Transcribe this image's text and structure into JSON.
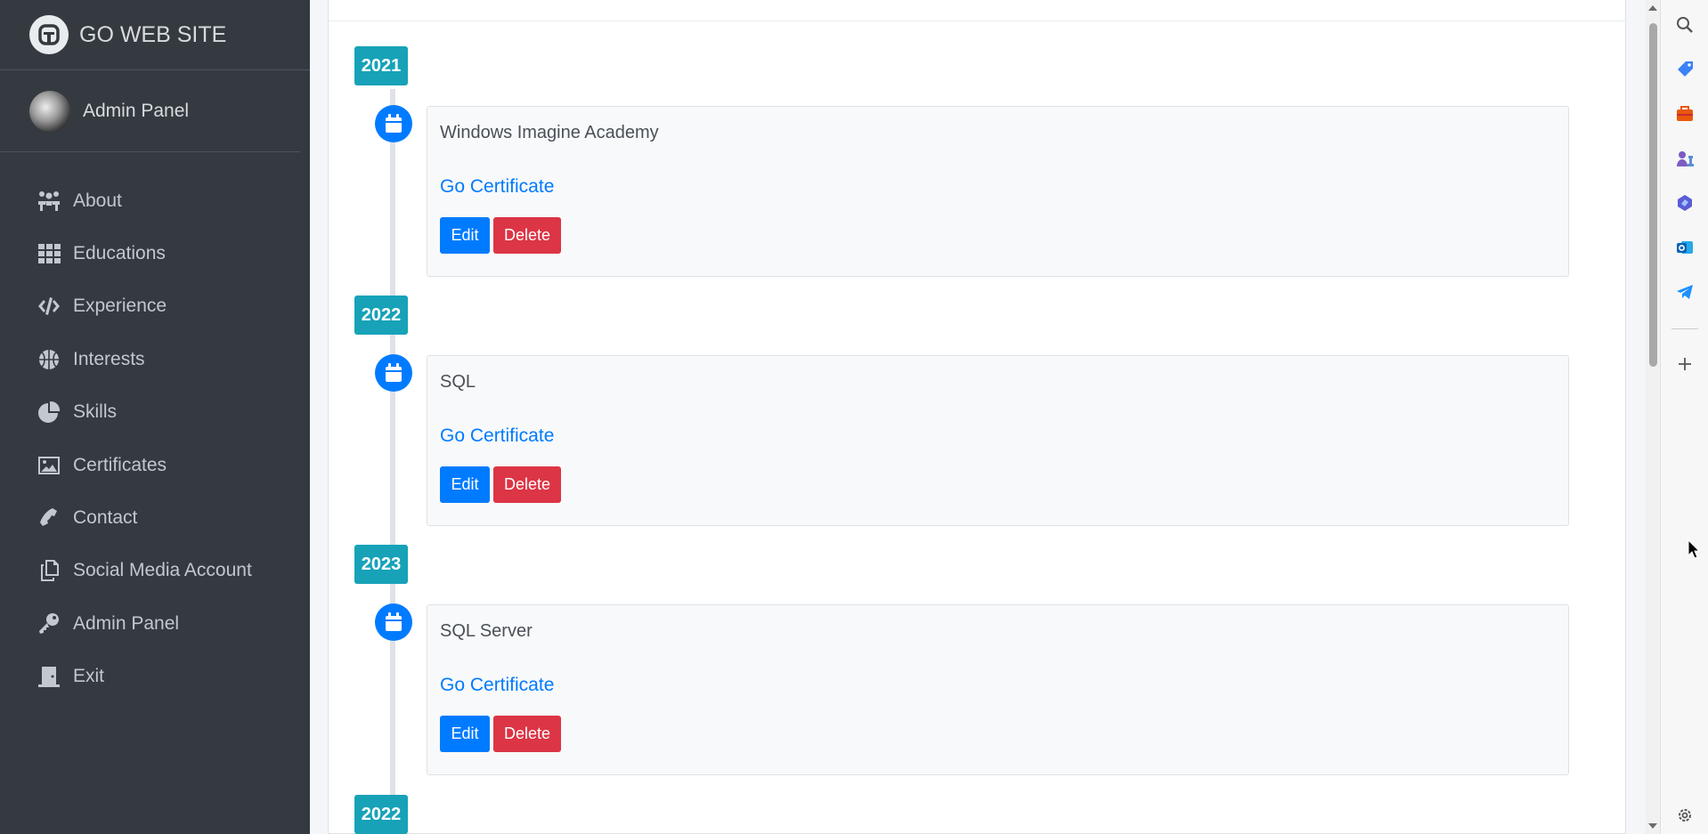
{
  "brand": {
    "name": "GO WEB SITE"
  },
  "user": {
    "name": "Admin Panel"
  },
  "sidebar": {
    "items": [
      {
        "label": "About",
        "icon": "users-icon"
      },
      {
        "label": "Educations",
        "icon": "grid-icon"
      },
      {
        "label": "Experience",
        "icon": "code-icon"
      },
      {
        "label": "Interests",
        "icon": "basketball-icon"
      },
      {
        "label": "Skills",
        "icon": "pie-chart-icon"
      },
      {
        "label": "Certificates",
        "icon": "image-icon"
      },
      {
        "label": "Contact",
        "icon": "phone-icon"
      },
      {
        "label": "Social Media Account",
        "icon": "copy-icon"
      },
      {
        "label": "Admin Panel",
        "icon": "key-icon"
      },
      {
        "label": "Exit",
        "icon": "door-exit-icon"
      }
    ]
  },
  "timeline": {
    "entries": [
      {
        "year": "2021",
        "title": "Windows Imagine Academy",
        "link": "Go Certificate",
        "edit": "Edit",
        "delete": "Delete"
      },
      {
        "year": "2022",
        "title": "SQL",
        "link": "Go Certificate",
        "edit": "Edit",
        "delete": "Delete"
      },
      {
        "year": "2023",
        "title": "SQL Server",
        "link": "Go Certificate",
        "edit": "Edit",
        "delete": "Delete"
      }
    ],
    "next_year": "2022"
  },
  "colors": {
    "sidebar_bg": "#343a40",
    "year_badge": "#17a2b8",
    "primary": "#007bff",
    "danger": "#dc3545"
  },
  "side_panel_icons": [
    "search-icon",
    "tag-icon",
    "briefcase-icon",
    "chess-icon",
    "copilot-icon",
    "outlook-icon",
    "telegram-icon",
    "add-icon",
    "settings-icon"
  ]
}
